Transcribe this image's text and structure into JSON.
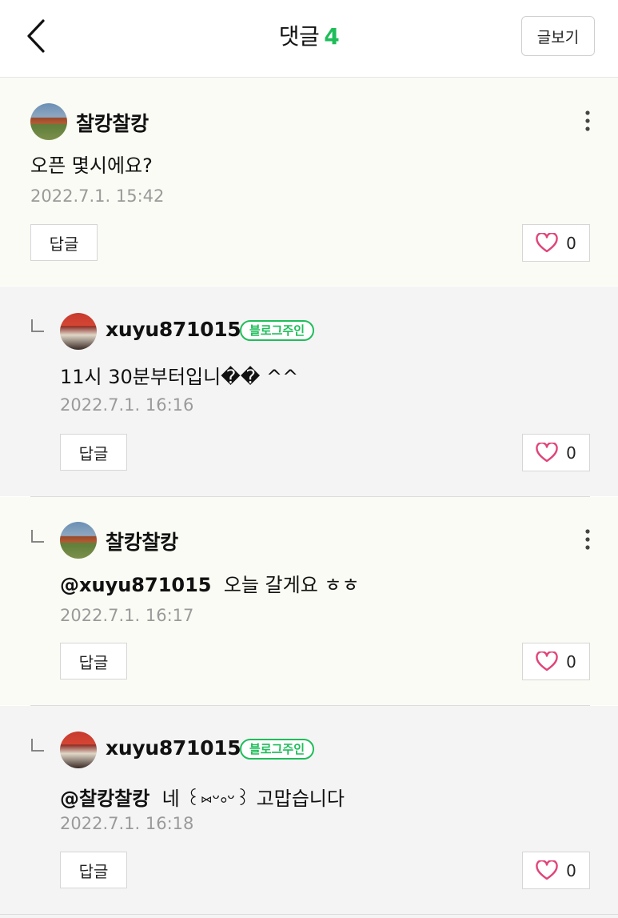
{
  "header": {
    "title": "댓글",
    "count": "4",
    "view_post_label": "글보기"
  },
  "colors": {
    "accent": "#1fbd5a",
    "like_heart": "#e0447a",
    "timestamp": "#9a9a9a"
  },
  "icons": [
    "back-chevron-icon",
    "more-vertical-icon",
    "heart-outline-icon",
    "reply-corner-icon"
  ],
  "comments": [
    {
      "author": "찰캉찰캉",
      "text": "오픈 몇시에요?",
      "time": "2022.7.1. 15:42",
      "reply_label": "답글",
      "likes": "0"
    },
    {
      "author": "xuyu871015",
      "badge": "블로그주인",
      "text": "11시 30분부터입니�� ^^",
      "time": "2022.7.1. 16:16",
      "reply_label": "답글",
      "likes": "0"
    },
    {
      "author": "찰캉찰캉",
      "mention": "@xuyu871015",
      "text": "오늘 갈게요 ㅎㅎ",
      "time": "2022.7.1. 16:17",
      "reply_label": "답글",
      "likes": "0"
    },
    {
      "author": "xuyu871015",
      "badge": "블로그주인",
      "mention": "@찰캉찰캉",
      "text": "네 ꒰⑅ᵕ༚ᵕ꒱ 고맙습니다",
      "time": "2022.7.1. 16:18",
      "reply_label": "답글",
      "likes": "0"
    }
  ]
}
